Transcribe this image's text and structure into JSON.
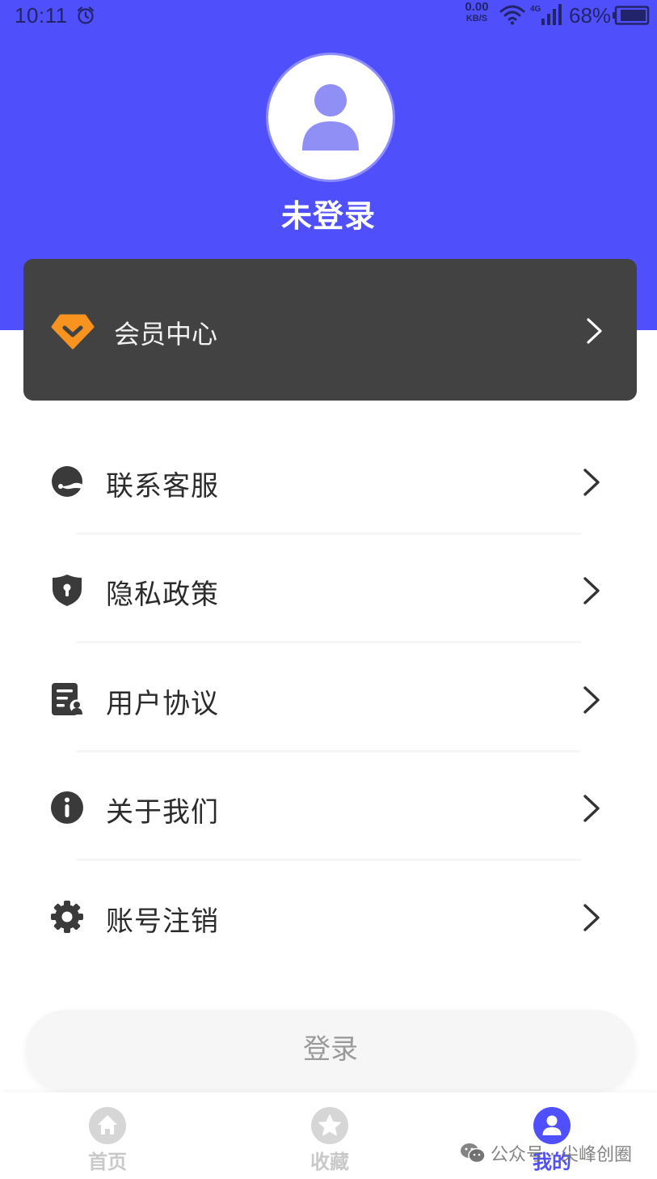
{
  "status_bar": {
    "time": "10:11",
    "net_speed_value": "0.00",
    "net_speed_unit": "KB/S",
    "network_type": "4G",
    "battery": "68%",
    "icons": [
      "alarm-icon",
      "wifi-icon",
      "signal-icon",
      "battery-icon"
    ]
  },
  "profile": {
    "avatar_icon": "user-icon",
    "name": "未登录"
  },
  "vip_card": {
    "icon": "diamond-icon",
    "label": "会员中心"
  },
  "menu": {
    "items": [
      {
        "label": "联系客服",
        "icon": "customer-service-icon"
      },
      {
        "label": "隐私政策",
        "icon": "shield-lock-icon"
      },
      {
        "label": "用户协议",
        "icon": "user-agreement-icon"
      },
      {
        "label": "关于我们",
        "icon": "info-icon"
      },
      {
        "label": "账号注销",
        "icon": "gear-icon"
      }
    ]
  },
  "login_button": {
    "label": "登录"
  },
  "tabbar": {
    "tabs": [
      {
        "label": "首页",
        "icon": "home-icon",
        "active": false
      },
      {
        "label": "收藏",
        "icon": "star-icon",
        "active": false
      },
      {
        "label": "我的",
        "icon": "user-icon",
        "active": true
      }
    ]
  },
  "watermark": {
    "text": "公众号 · 尖峰创圈"
  },
  "colors": {
    "brand": "#4f4ffc",
    "vip_card_bg": "#434242",
    "vip_icon": "#f7931e",
    "text": "#2b2b2b",
    "inactive_tab": "#c9c9c9"
  }
}
